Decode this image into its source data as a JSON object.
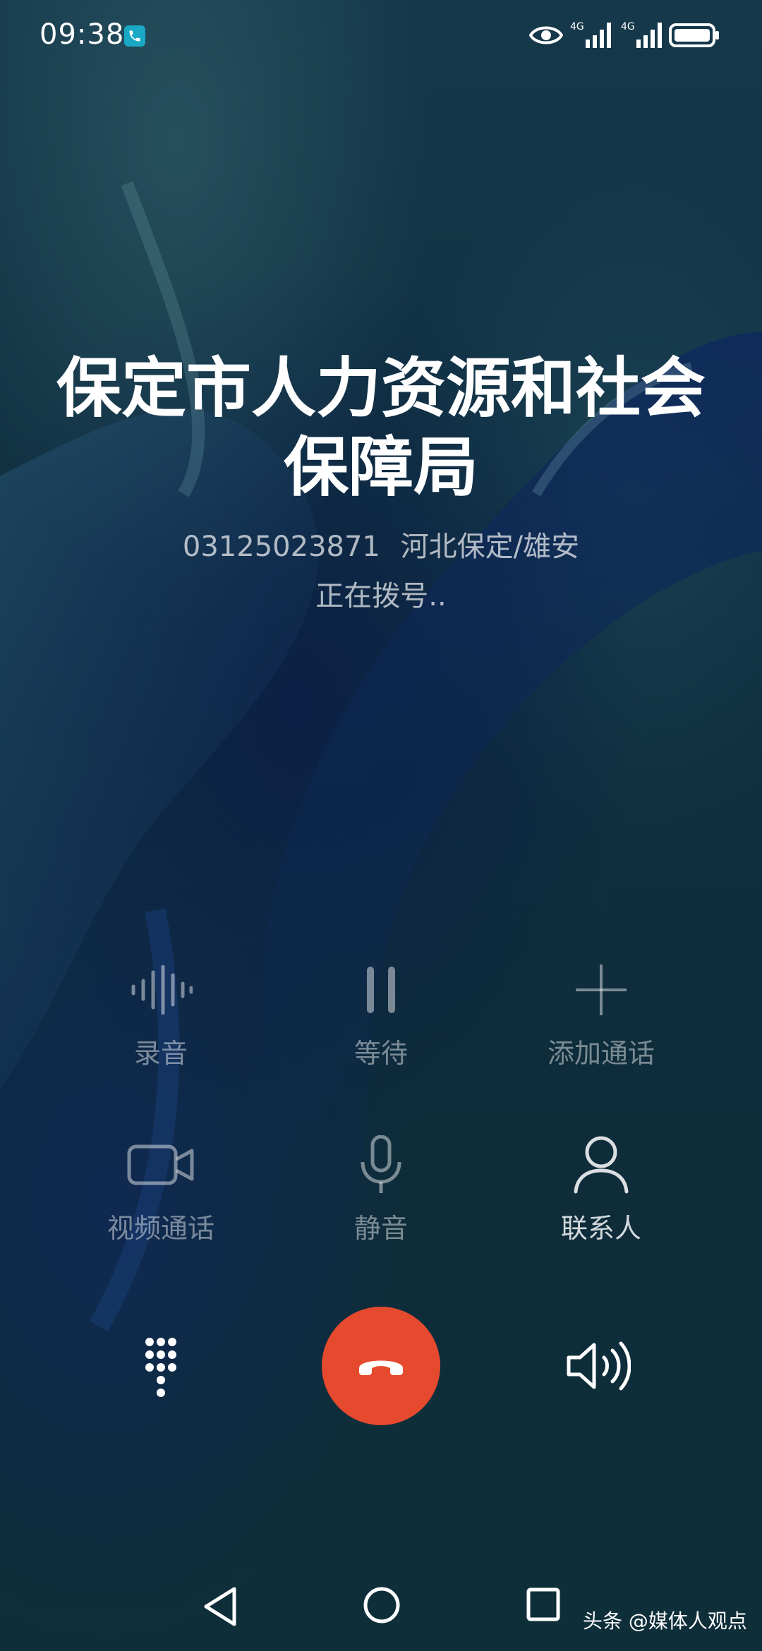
{
  "status_bar": {
    "time": "09:38",
    "network_1": "4G",
    "network_2": "4G"
  },
  "caller": {
    "name": "保定市人力资源和社会保障局",
    "number": "03125023871",
    "location": "河北保定/雄安",
    "status": "正在拨号.."
  },
  "controls": {
    "record": "录音",
    "hold": "等待",
    "add_call": "添加通话",
    "video_call": "视频通话",
    "mute": "静音",
    "contacts": "联系人"
  },
  "watermark": "头条 @媒体人观点",
  "colors": {
    "end_call": "#e64a2e",
    "call_indicator": "#19a9c5"
  },
  "icons": [
    "phone-icon",
    "eye-icon",
    "signal-icon",
    "battery-icon",
    "waveform-icon",
    "pause-icon",
    "plus-icon",
    "video-camera-icon",
    "microphone-icon",
    "person-icon",
    "dialpad-icon",
    "end-call-icon",
    "speaker-icon",
    "back-icon",
    "home-icon",
    "recents-icon"
  ]
}
